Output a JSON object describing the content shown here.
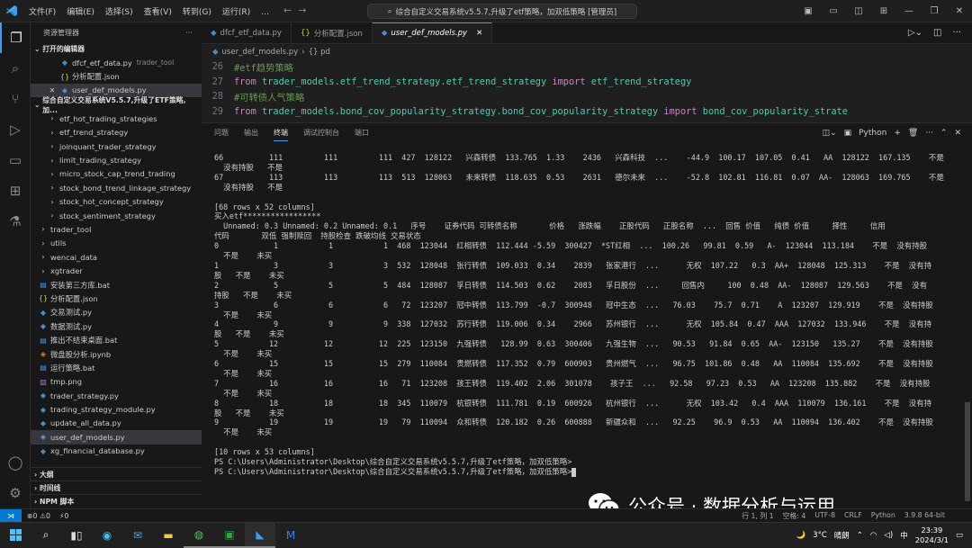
{
  "menu": [
    "文件(F)",
    "编辑(E)",
    "选择(S)",
    "查看(V)",
    "转到(G)",
    "运行(R)",
    "…"
  ],
  "command_center": "综合自定义交易系统v5.5.7,升级了etf策略，加双低策略 [管理员]",
  "explorer": {
    "title": "资源管理器",
    "open_editors_label": "打开的编辑器",
    "open_editors": [
      {
        "name": "dfcf_etf_data.py",
        "hint": "trader_tool",
        "icon": "py"
      },
      {
        "name": "分析配置.json",
        "hint": "",
        "icon": "json"
      },
      {
        "name": "user_def_models.py",
        "hint": "",
        "icon": "py",
        "selected": true
      }
    ],
    "workspace_label": "综合自定义交易系统V5.5.7,升级了ETF策略, 加...",
    "tree": [
      {
        "name": "etf_hot_trading_strategies",
        "icon": "chevron",
        "indent": 2
      },
      {
        "name": "etf_trend_strategy",
        "icon": "chevron",
        "indent": 2
      },
      {
        "name": "joinquant_trader_strategy",
        "icon": "chevron",
        "indent": 2
      },
      {
        "name": "limit_trading_strategy",
        "icon": "chevron",
        "indent": 2
      },
      {
        "name": "micro_stock_cap_trend_trading",
        "icon": "chevron",
        "indent": 2
      },
      {
        "name": "stock_bond_trend_linkage_strategy",
        "icon": "chevron",
        "indent": 2
      },
      {
        "name": "stock_hot_concept_strategy",
        "icon": "chevron",
        "indent": 2
      },
      {
        "name": "stock_sentiment_strategy",
        "icon": "chevron",
        "indent": 2
      },
      {
        "name": "trader_tool",
        "icon": "chevron",
        "indent": 1
      },
      {
        "name": "utils",
        "icon": "chevron",
        "indent": 1
      },
      {
        "name": "wencai_data",
        "icon": "chevron",
        "indent": 1
      },
      {
        "name": "xgtrader",
        "icon": "chevron",
        "indent": 1
      },
      {
        "name": "安装第三方库.bat",
        "icon": "bat",
        "indent": 1
      },
      {
        "name": "分析配置.json",
        "icon": "json",
        "indent": 1
      },
      {
        "name": "交易测试.py",
        "icon": "py",
        "indent": 1
      },
      {
        "name": "数据测试.py",
        "icon": "py",
        "indent": 1
      },
      {
        "name": "推出不结束桌面.bat",
        "icon": "bat",
        "indent": 1
      },
      {
        "name": "微盘股分析.ipynb",
        "icon": "nb",
        "indent": 1
      },
      {
        "name": "运行策略.bat",
        "icon": "bat",
        "indent": 1
      },
      {
        "name": "tmp.png",
        "icon": "img",
        "indent": 1
      },
      {
        "name": "trader_strategy.py",
        "icon": "py",
        "indent": 1
      },
      {
        "name": "trading_strategy_module.py",
        "icon": "py",
        "indent": 1
      },
      {
        "name": "update_all_data.py",
        "icon": "py",
        "indent": 1
      },
      {
        "name": "user_def_models.py",
        "icon": "py",
        "indent": 1,
        "selected": true
      },
      {
        "name": "xg_financial_database.py",
        "icon": "py",
        "indent": 1
      }
    ],
    "bottom_sections": [
      "大纲",
      "时间线",
      "NPM 脚本"
    ]
  },
  "tabs": [
    {
      "label": "dfcf_etf_data.py",
      "icon": "py",
      "active": false
    },
    {
      "label": "分析配置.json",
      "icon": "json",
      "active": false
    },
    {
      "label": "user_def_models.py",
      "icon": "py",
      "active": true
    }
  ],
  "breadcrumb": [
    "user_def_models.py",
    "{} pd"
  ],
  "code_lines": [
    {
      "n": "26",
      "parts": [
        [
          "cmt",
          "#etf趋势策略"
        ]
      ]
    },
    {
      "n": "27",
      "parts": [
        [
          "kw",
          "from "
        ],
        [
          "id",
          "trader_models.etf_trend_strategy.etf_trend_strategy"
        ],
        [
          "kw",
          " import "
        ],
        [
          "id",
          "etf_trend_strategy"
        ]
      ]
    },
    {
      "n": "28",
      "parts": [
        [
          "cmt",
          "#可转债人气策略"
        ]
      ]
    },
    {
      "n": "29",
      "parts": [
        [
          "kw",
          "from "
        ],
        [
          "id",
          "trader_models.bond_cov_popularity_strategy.bond_cov_popularity_strategy"
        ],
        [
          "kw",
          " import "
        ],
        [
          "id",
          "bond_cov_popularity_strate"
        ]
      ]
    }
  ],
  "panel_tabs": [
    "问题",
    "输出",
    "终端",
    "调试控制台",
    "端口"
  ],
  "panel_active": "终端",
  "panel_shell": "Python",
  "terminal_lines": [
    "66          111         111         111  427  128122   兴森转债  133.765  1.33    2436   兴森科技  ...    -44.9  100.17  107.05  0.41   AA  128122  167.135    不是",
    "  没有持股   不是",
    "67          113         113         113  513  128063   未来转债  118.635  0.53    2631   德尔未来  ...    -52.8  102.81  116.81  0.07  AA-  128063  169.765    不是",
    "  没有持股   不是",
    "",
    "[68 rows x 52 columns]",
    "买入etf*****************",
    "  Unnamed: 0.3 Unnamed: 0.2 Unnamed: 0.1   序号    证券代码 可转债名称       价格   涨跌幅    正股代码   正股名称  ...  回售 价值   纯债 价值     择性     信用",
    "代码       双低 强制赎回  持股检查 跌破均线 交易状态",
    "0            1           1           1  468  123044  红相转债  112.444 -5.59  300427  *ST红相  ...  100.26   99.81  0.59   A-  123044  113.184    不是  没有持股",
    "  不是    未买",
    "1            3           3           3  532  128048  张行转债  109.033  0.34    2839   张家港行  ...      无权  107.22   0.3  AA+  128048  125.313    不是  没有持",
    "股   不是    未买",
    "2            5           5           5  484  128087  孚日转债  114.503  0.62    2083   孚日股份  ...     回售内     100  0.48  AA-  128087  129.563    不是  没有",
    "持股   不是    未买",
    "3            6           6           6   72  123207  冠中转债  113.799  -0.7  300948   冠中生态  ...   76.03    75.7  0.71    A  123207  129.919    不是  没有持股",
    "  不是    未买",
    "4            9           9           9  338  127032  苏行转债  119.006  0.34    2966   苏州银行  ...      无权  105.84  0.47  AAA  127032  133.946    不是  没有持",
    "股   不是    未买",
    "5           12          12          12  225  123150  九强转债   128.99  0.63  300406   九强生物  ...   90.53   91.84  0.65  AA-  123150   135.27    不是  没有持股",
    "  不是    未买",
    "6           15          15          15  279  110084  贵燃转债  117.352  0.79  600903   贵州燃气  ...   96.75  101.86  0.48   AA  110084  135.692    不是  没有持股",
    "  不是    未买",
    "7           16          16          16   71  123208  孩王转债  119.402  2.06  301078    孩子王  ...   92.58   97.23  0.53   AA  123208  135.882    不是  没有持股",
    "  不是    未买",
    "8           18          18          18  345  110079  杭银转债  111.781  0.19  600926   杭州银行  ...      无权  103.42   0.4  AAA  110079  136.161    不是  没有持",
    "股   不是    未买",
    "9           19          19          19   79  110094  众和转债  120.182  0.26  600888   新疆众和  ...   92.25    96.9  0.53   AA  110094  136.402    不是  没有持股",
    "  不是    未买",
    "",
    "[10 rows x 53 columns]",
    "PS C:\\Users\\Administrator\\Desktop\\综合自定义交易系统v5.5.7,升级了etf策略，加双低策略>",
    "PS C:\\Users\\Administrator\\Desktop\\综合自定义交易系统v5.5.7,升级了etf策略，加双低策略>"
  ],
  "watermark": "公众号 · 数据分析与运用",
  "status": {
    "errors": "⊗0 ⚠0",
    "ports": "⚡0",
    "position": "行 1, 列 1",
    "spaces": "空格: 4",
    "encoding": "UTF-8",
    "eol": "CRLF",
    "language": "Python",
    "version": "3.9.8 64-bit"
  },
  "taskbar": {
    "weather_temp": "3°C",
    "weather_text": "晴朗",
    "ime": "中",
    "time": "23:39",
    "date": "2024/3/1"
  },
  "colors": {
    "accent": "#0078d4",
    "folder_icon": "#e8c07a",
    "py_icon": "#4b8bbe",
    "json_icon": "#cbcb41"
  }
}
